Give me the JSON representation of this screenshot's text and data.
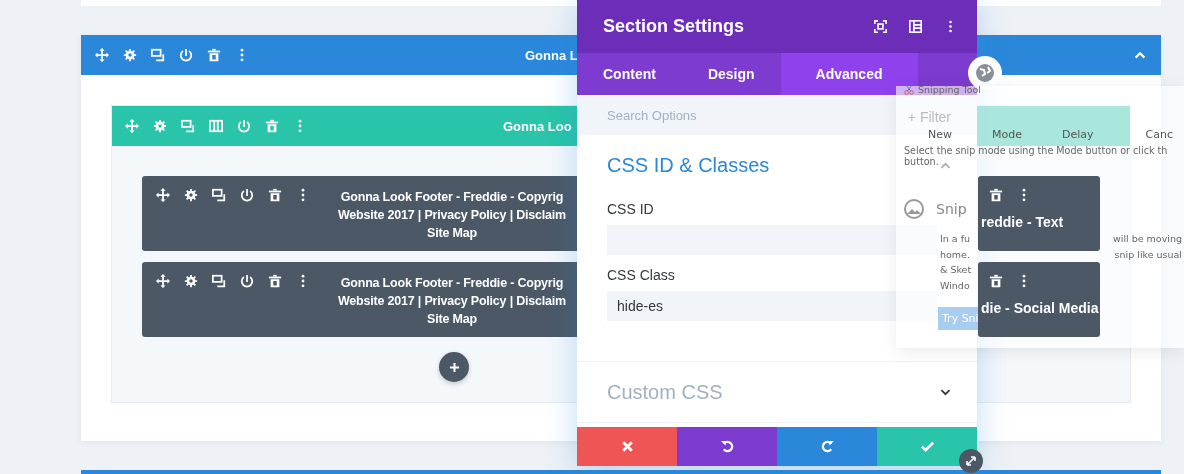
{
  "builder": {
    "section": {
      "title": "Gonna L",
      "expanded": true
    },
    "row": {
      "title": "Gonna Loo"
    },
    "column_1": [
      {
        "lines": [
          "Gonna Look Footer - Freddie - Copyrig",
          "Website 2017 | Privacy Policy | Disclaim",
          "Site Map"
        ]
      },
      {
        "lines": [
          "Gonna Look Footer - Freddie - Copyrig",
          "Website 2017 | Privacy Policy | Disclaim",
          "Site Map"
        ]
      }
    ],
    "column_2": [
      {
        "title": "reddie - Text"
      },
      {
        "title": "die - Social Media"
      }
    ]
  },
  "modal": {
    "title": "Section Settings",
    "tabs": [
      {
        "label": "Content",
        "selected": false
      },
      {
        "label": "Design",
        "selected": false
      },
      {
        "label": "Advanced",
        "selected": true
      }
    ],
    "search": {
      "placeholder": "Search Options"
    },
    "filter": "+ Filter",
    "groups": [
      {
        "title": "CSS ID & Classes",
        "expanded": true,
        "fields": [
          {
            "label": "CSS ID"
          },
          {
            "label": "CSS Class",
            "value": "hide-es"
          }
        ]
      },
      {
        "title": "Custom CSS",
        "expanded": false
      }
    ]
  },
  "snipping_tool": {
    "title": "Snipping Tool",
    "toolbar": [
      "New",
      "Mode",
      "Delay",
      "Canc"
    ],
    "hint": [
      "Select the snip mode using the Mode button or click th",
      "button."
    ],
    "notice_title": "Snip",
    "notice_lines": [
      {
        "start": "In a fu",
        "end": "will be moving"
      },
      {
        "start": "home.",
        "end": "snip like usual"
      },
      {
        "start": "& Sket"
      },
      {
        "start": "Windo"
      }
    ],
    "button": "Try Sni"
  }
}
